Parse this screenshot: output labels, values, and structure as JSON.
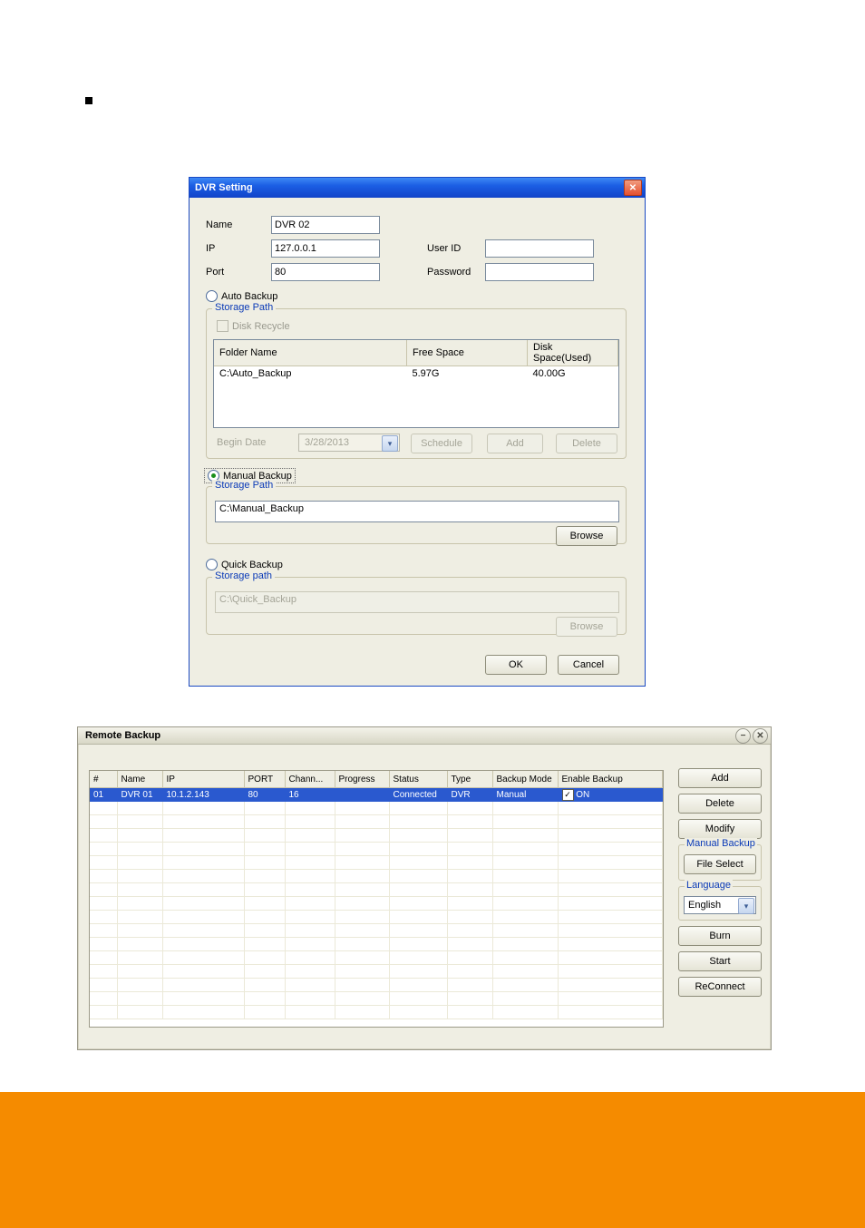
{
  "dvr_dialog": {
    "title": "DVR Setting",
    "name_label": "Name",
    "name_value": "DVR 02",
    "ip_label": "IP",
    "ip_value": "127.0.0.1",
    "port_label": "Port",
    "port_value": "80",
    "userid_label": "User ID",
    "userid_value": "",
    "password_label": "Password",
    "password_value": "",
    "auto_backup_label": "Auto Backup",
    "manual_backup_label": "Manual Backup",
    "quick_backup_label": "Quick Backup",
    "storage_path_legend": "Storage Path",
    "storage_path_legend2": "Storage path",
    "disk_recycle_label": "Disk Recycle",
    "grid_cols": [
      "Folder Name",
      "Free Space",
      "Disk Space(Used)"
    ],
    "grid_row": [
      "C:\\Auto_Backup",
      "5.97G",
      "40.00G"
    ],
    "begin_date_label": "Begin Date",
    "begin_date_value": "3/28/2013",
    "schedule_btn": "Schedule",
    "add_btn": "Add",
    "delete_btn": "Delete",
    "manual_path": "C:\\Manual_Backup",
    "quick_path": "C:\\Quick_Backup",
    "browse_btn": "Browse",
    "ok_btn": "OK",
    "cancel_btn": "Cancel"
  },
  "remote_backup": {
    "title": "Remote Backup",
    "cols": [
      "#",
      "Name",
      "IP",
      "PORT",
      "Chann...",
      "Progress",
      "Status",
      "Type",
      "Backup Mode",
      "Enable Backup"
    ],
    "row": {
      "num": "01",
      "name": "DVR 01",
      "ip": "10.1.2.143",
      "port": "80",
      "chan": "16",
      "progress": "",
      "status": "Connected",
      "type": "DVR",
      "mode": "Manual",
      "enable": "ON"
    },
    "side": {
      "add": "Add",
      "delete": "Delete",
      "modify": "Modify",
      "manual_legend": "Manual Backup",
      "file_select": "File Select",
      "lang_legend": "Language",
      "lang_value": "English",
      "burn": "Burn",
      "start": "Start",
      "reconnect": "ReConnect"
    }
  }
}
